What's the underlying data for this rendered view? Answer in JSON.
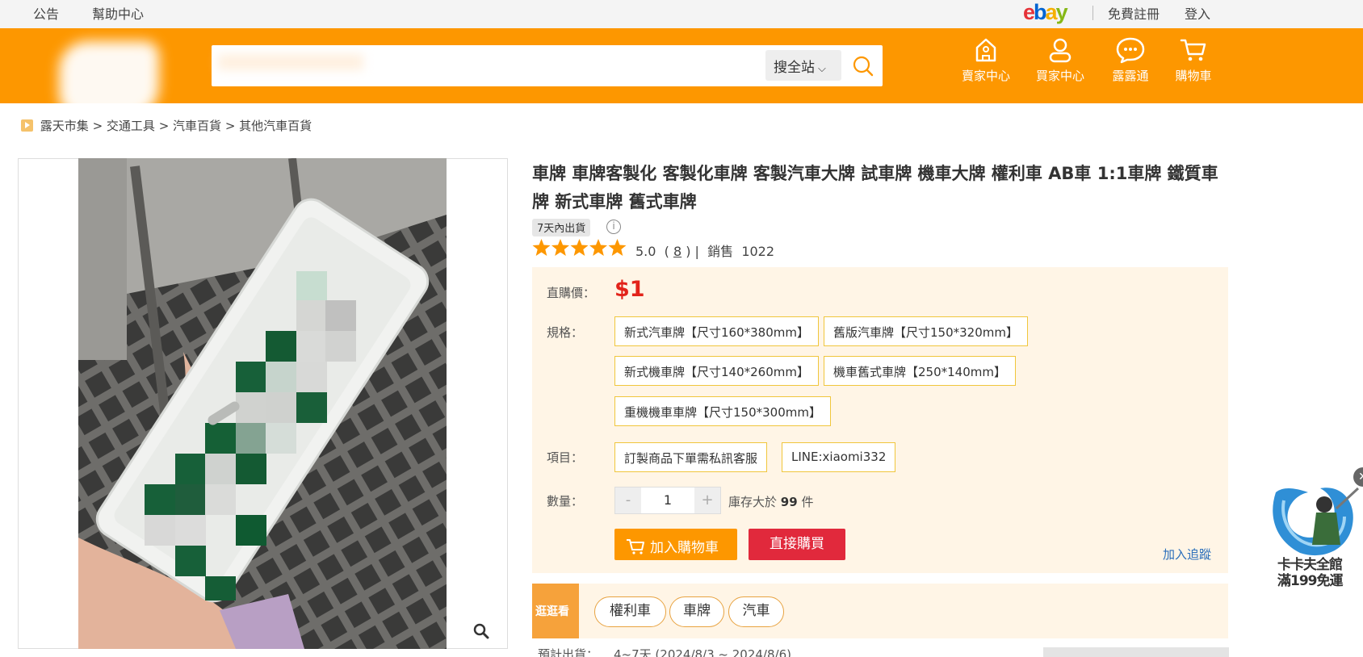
{
  "topbar": {
    "announcement": "公告",
    "help": "幫助中心",
    "ebay": {
      "e": "e",
      "b": "b",
      "a": "a",
      "y": "y"
    },
    "register": "免費註冊",
    "login": "登入"
  },
  "header": {
    "search_scope": "搜全站",
    "icons": [
      {
        "label": "賣家中心",
        "icon": "store-icon"
      },
      {
        "label": "買家中心",
        "icon": "user-icon"
      },
      {
        "label": "露露通",
        "icon": "chat-icon"
      },
      {
        "label": "購物車",
        "icon": "cart-icon"
      }
    ],
    "brand_color": "#fd9700"
  },
  "breadcrumb": [
    "露天市集",
    "交通工具",
    "汽車百貨",
    "其他汽車百貨"
  ],
  "product": {
    "title": "車牌 車牌客製化 客製化車牌 客製汽車大牌 試車牌 機車大牌 權利車 AB車 1:1車牌 鐵質車牌 新式車牌 舊式車牌",
    "ship_tag": "7天內出貨",
    "rating": "5.0",
    "stars": 5,
    "review_count": "8",
    "sold_label": "銷售",
    "sold": "1022",
    "price_label": "直購價：",
    "price": "$1",
    "spec_label": "規格：",
    "specs": [
      "新式汽車牌【尺寸160*380mm】",
      "舊版汽車牌【尺寸150*320mm】",
      "新式機車牌【尺寸140*260mm】",
      "機車舊式車牌【250*140mm】",
      "重機機車車牌【尺寸150*300mm】"
    ],
    "item_label": "項目：",
    "items": [
      "訂製商品下單需私訊客服",
      "LINE:xiaomi332"
    ],
    "qty_label": "數量：",
    "qty_minus": "-",
    "qty_value": "1",
    "qty_plus": "+",
    "stock_prefix": "庫存大於",
    "stock": "99",
    "stock_unit": "件",
    "add_to_cart": "加入購物車",
    "buy_now": "直接購買",
    "track": "加入追蹤",
    "accent_red": "#e2231a"
  },
  "browse": {
    "tag": "逛逛看",
    "pills": [
      "權利車",
      "車牌",
      "汽車"
    ]
  },
  "shipping": {
    "label": "預計出貨：",
    "value": "4~7天 (2024/8/3 ~ 2024/8/6)"
  },
  "promo": {
    "line1": "卡卡夫全館",
    "line2": "滿199免運"
  }
}
